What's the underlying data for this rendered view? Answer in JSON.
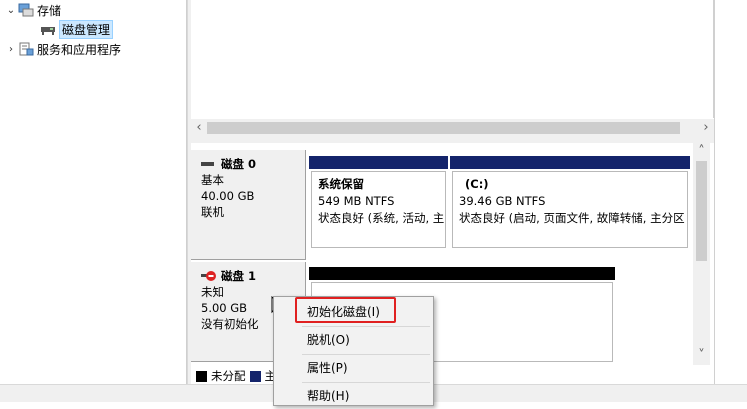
{
  "tree": {
    "items": [
      {
        "label": "存储",
        "arrow": "⌄"
      },
      {
        "label": "磁盘管理"
      },
      {
        "label": "服务和应用程序",
        "arrow": "›"
      }
    ]
  },
  "scroll": {
    "left": "‹",
    "right": "›",
    "up": "˄",
    "down": "˅"
  },
  "disks": [
    {
      "name": "磁盘 0",
      "type": "基本",
      "size": "40.00 GB",
      "status": "联机",
      "partitions": [
        {
          "title": "系统保留",
          "size": "549 MB NTFS",
          "health": "状态良好 (系统, 活动, 主"
        },
        {
          "title": "(C:)",
          "size": "39.46 GB NTFS",
          "health": "状态良好 (启动, 页面文件, 故障转储, 主分区"
        }
      ]
    },
    {
      "name": "磁盘 1",
      "type": "未知",
      "size": "5.00 GB",
      "status": "没有初始化"
    }
  ],
  "legend": {
    "unallocated": "未分配",
    "primary_partial": "主",
    "colors": {
      "unallocated": "#000000",
      "primary": "#14246b"
    }
  },
  "context_menu": {
    "items": [
      "初始化磁盘(I)",
      "脱机(O)",
      "属性(P)",
      "帮助(H)"
    ],
    "highlight_color": "#e02020"
  }
}
